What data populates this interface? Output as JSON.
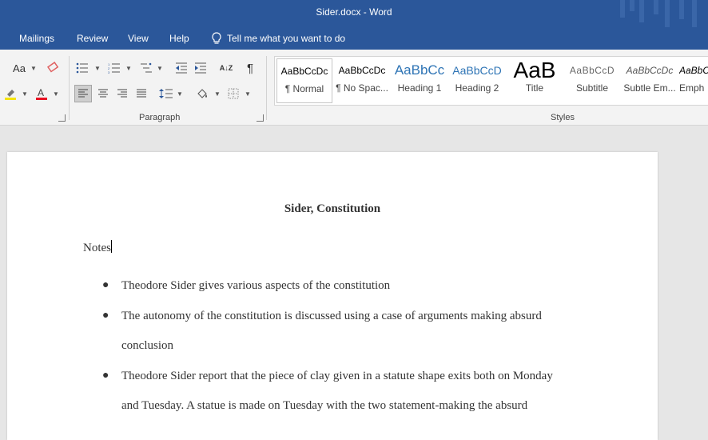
{
  "window": {
    "title": "Sider.docx  -  Word"
  },
  "menu": {
    "items": [
      {
        "label": "Mailings"
      },
      {
        "label": "Review"
      },
      {
        "label": "View"
      },
      {
        "label": "Help"
      }
    ],
    "tell_me": "Tell me what you want to do"
  },
  "ribbon": {
    "font_change_case": "Aa",
    "sort_icon": "A↓Z",
    "pilcrow": "¶",
    "paragraph_label": "Paragraph",
    "styles_label": "Styles",
    "colors": {
      "highlight": "#f5e400",
      "font_color": "#e81123",
      "accent": "#2b579a"
    },
    "styles": [
      {
        "preview": "AaBbCcDc",
        "label": "¶ Normal"
      },
      {
        "preview": "AaBbCcDc",
        "label": "¶ No Spac..."
      },
      {
        "preview": "AaBbCc",
        "label": "Heading 1"
      },
      {
        "preview": "AaBbCcD",
        "label": "Heading 2"
      },
      {
        "preview": "AaB",
        "label": "Title"
      },
      {
        "preview": "AaBbCcD",
        "label": "Subtitle"
      },
      {
        "preview": "AaBbCcDc",
        "label": "Subtle Em..."
      },
      {
        "preview": "AaBbCcDc",
        "label": "Emph"
      }
    ]
  },
  "document": {
    "heading": "Sider, Constitution",
    "notes": "Notes",
    "bullets": [
      {
        "lines": [
          "Theodore Sider gives various aspects of the constitution"
        ]
      },
      {
        "lines": [
          "The autonomy of the constitution is discussed using a case of arguments making absurd",
          "conclusion"
        ]
      },
      {
        "lines": [
          "Theodore Sider report that the piece of clay given in a statute shape exits both on Monday",
          "and Tuesday. A statue is made on Tuesday with the two statement-making the absurd"
        ]
      }
    ]
  }
}
